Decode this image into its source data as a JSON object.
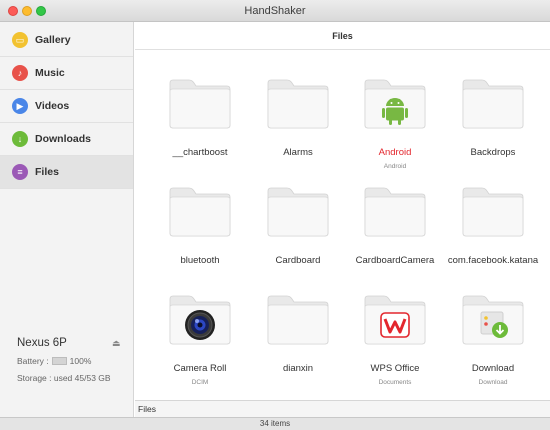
{
  "window": {
    "title": "HandShaker"
  },
  "sidebar": {
    "items": [
      {
        "label": "Gallery",
        "icon": "image-icon",
        "color": "#f2c230",
        "glyph": "▭"
      },
      {
        "label": "Music",
        "icon": "music-note-icon",
        "color": "#e8524a",
        "glyph": "♪"
      },
      {
        "label": "Videos",
        "icon": "play-icon",
        "color": "#4a86e8",
        "glyph": "▶"
      },
      {
        "label": "Downloads",
        "icon": "download-icon",
        "color": "#6dbb3a",
        "glyph": "↓"
      },
      {
        "label": "Files",
        "icon": "document-icon",
        "color": "#9b59b6",
        "glyph": "≡"
      }
    ],
    "active": "Files",
    "device": {
      "name": "Nexus 6P",
      "battery_label": "Battery :",
      "battery_value": "100%",
      "storage": "Storage : used 45/53 GB"
    }
  },
  "content": {
    "title": "Files",
    "folders": [
      {
        "name": "__chartboost",
        "subtitle": "",
        "badge": ""
      },
      {
        "name": "Alarms",
        "subtitle": "",
        "badge": ""
      },
      {
        "name": "Android",
        "subtitle": "Android",
        "badge": "android-robot-icon",
        "highlight": true
      },
      {
        "name": "Backdrops",
        "subtitle": "",
        "badge": ""
      },
      {
        "name": "bluetooth",
        "subtitle": "",
        "badge": ""
      },
      {
        "name": "Cardboard",
        "subtitle": "",
        "badge": ""
      },
      {
        "name": "CardboardCamera",
        "subtitle": "",
        "badge": ""
      },
      {
        "name": "com.facebook.katana",
        "subtitle": "",
        "badge": ""
      },
      {
        "name": "Camera Roll",
        "subtitle": "DCIM",
        "badge": "camera-lens-icon"
      },
      {
        "name": "dianxin",
        "subtitle": "",
        "badge": ""
      },
      {
        "name": "WPS Office",
        "subtitle": "Documents",
        "badge": "wps-logo-icon"
      },
      {
        "name": "Download",
        "subtitle": "Download",
        "badge": "download-folder-icon"
      }
    ]
  },
  "pathbar": {
    "path": "Files"
  },
  "status": {
    "items": "34 items"
  },
  "colors": {
    "highlight": "#e3262d",
    "android": "#78b843",
    "wps": "#e3262d",
    "download": "#6dbb3a"
  }
}
